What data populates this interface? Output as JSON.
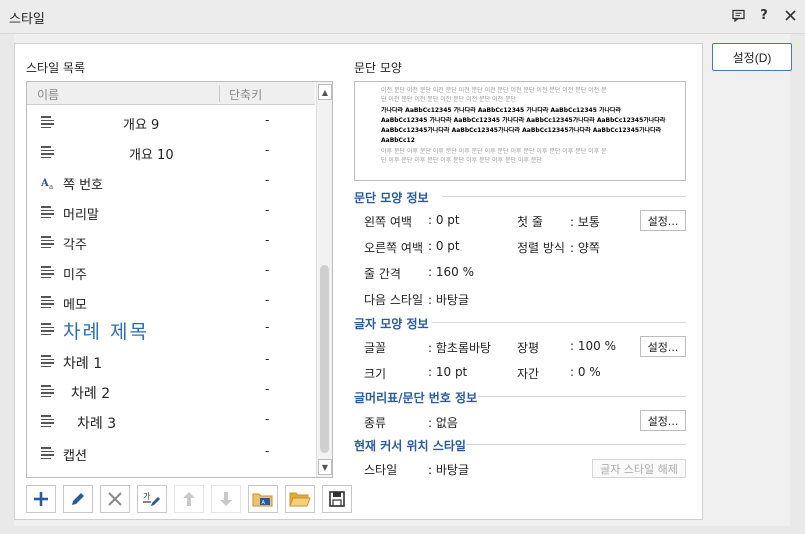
{
  "window": {
    "title": "스타일"
  },
  "ok_button": {
    "label": "설정(D)"
  },
  "style_list": {
    "title": "스타일 목록",
    "col_name": "이름",
    "col_key": "단축키",
    "items": [
      {
        "name": "개요 9",
        "key": "-",
        "indent": 96
      },
      {
        "name": "개요 10",
        "key": "-",
        "indent": 102
      },
      {
        "name": "쪽 번호",
        "key": "-",
        "indent": 36
      },
      {
        "name": "머리말",
        "key": "-",
        "indent": 36
      },
      {
        "name": "각주",
        "key": "-",
        "indent": 36
      },
      {
        "name": "미주",
        "key": "-",
        "indent": 36
      },
      {
        "name": "메모",
        "key": "-",
        "indent": 36
      },
      {
        "name": "차례 제목",
        "key": "-",
        "indent": 36
      },
      {
        "name": "차례 1",
        "key": "-",
        "indent": 36
      },
      {
        "name": "차례 2",
        "key": "-",
        "indent": 44
      },
      {
        "name": "차례 3",
        "key": "-",
        "indent": 50
      },
      {
        "name": "캡션",
        "key": "-",
        "indent": 36
      }
    ]
  },
  "preview": {
    "title": "문단 모양",
    "line1": "이전 문단 이전 문단 이전 문단 이전 문단 이전 문단 이전 문단 이전 문단 이전 문단 이전 문",
    "line2": "단 이전 문단 이전 문단 이전 문단 이전 문단 이전 문단",
    "line3": "가나다라 AaBbCc12345      가나다라 AaBbCc12345      가나다라 AaBbCc12345      가나다라",
    "line4": "AaBbCc12345 가나다라 AaBbCc12345  가나다라 AaBbCc12345가나다라 AaBbCc12345가나다라",
    "line5": "AaBbCc12345가나다라 AaBbCc12345가나다라 AaBbCc12345가나다라 AaBbCc12345가나다라",
    "line6": "AaBbCc12",
    "line7": "이후 문단 이후 문단 이후 문단 이후 문단 이후 문단 이후 문단 이후 문단 이후 문단 이후 문",
    "line8": "단 이후 문단 이후 문단 이후 문단 이후 문단 이후 문단 이후 문단"
  },
  "para_info": {
    "title": "문단 모양 정보",
    "left_margin_label": "왼쪽 여백",
    "left_margin_value": ": 0 pt",
    "right_margin_label": "오른쪽 여백",
    "right_margin_value": ": 0 pt",
    "line_spacing_label": "줄 간격",
    "line_spacing_value": ": 160 %",
    "next_style_label": "다음 스타일",
    "next_style_value": ": 바탕글",
    "first_line_label": "첫 줄",
    "first_line_value": ": 보통",
    "align_label": "정렬 방식",
    "align_value": ": 양쪽",
    "set_button": "설정..."
  },
  "char_info": {
    "title": "글자 모양 정보",
    "font_label": "글꼴",
    "font_value": ": 함초롬바탕",
    "size_label": "크기",
    "size_value": ": 10 pt",
    "ratio_label": "장평",
    "ratio_value": ": 100 %",
    "spacing_label": "자간",
    "spacing_value": ": 0 %",
    "set_button": "설정..."
  },
  "bullet_info": {
    "title": "글머리표/문단 번호 정보",
    "kind_label": "종류",
    "kind_value": ": 없음",
    "set_button": "설정..."
  },
  "cursor_style": {
    "title": "현재 커서 위치 스타일",
    "style_label": "스타일",
    "style_value": ": 바탕글",
    "release_button": "글자 스타일 해제"
  },
  "colors": {
    "accent": "#2a5a9e",
    "toc_title": "#2f6fb0",
    "ok_border": "#4a78b8"
  }
}
